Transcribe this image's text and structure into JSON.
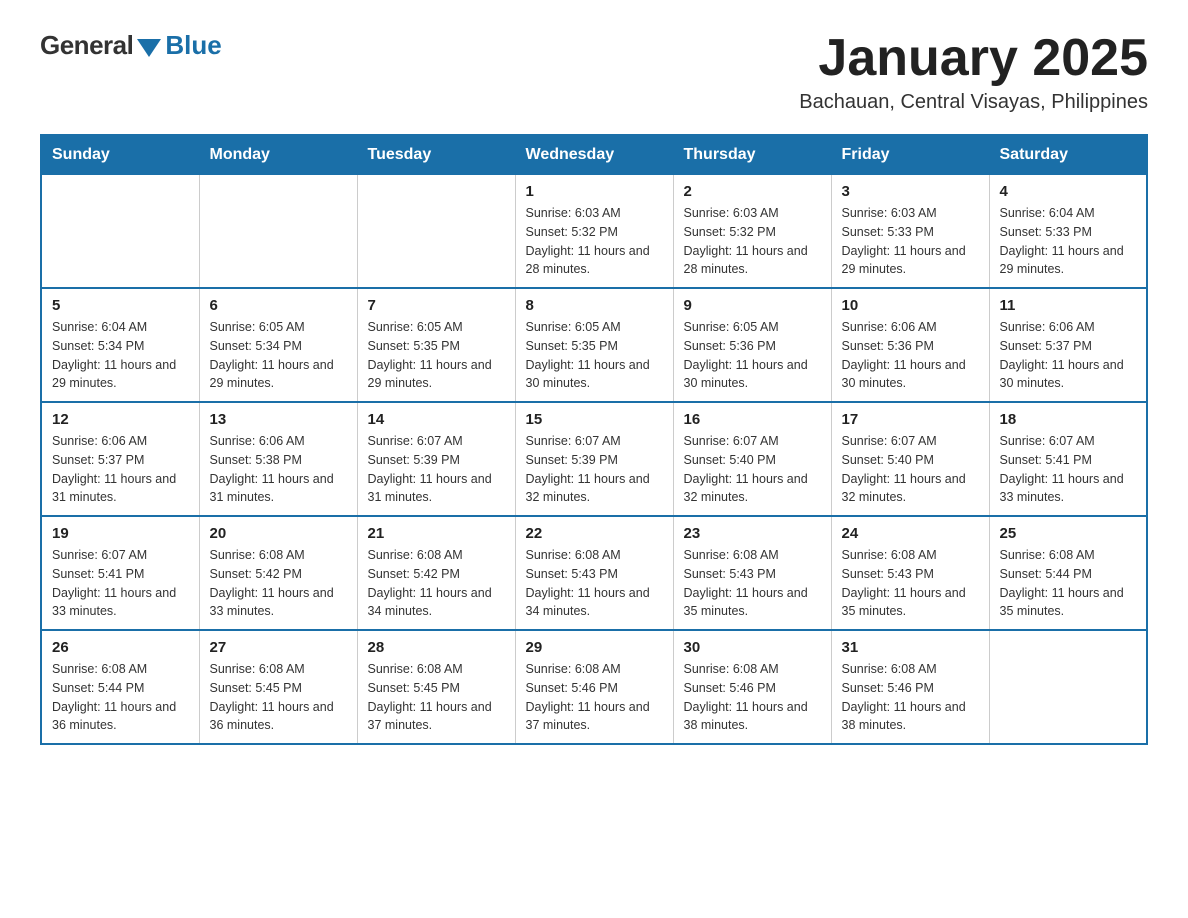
{
  "logo": {
    "general": "General",
    "blue": "Blue"
  },
  "title": "January 2025",
  "location": "Bachauan, Central Visayas, Philippines",
  "weekdays": [
    "Sunday",
    "Monday",
    "Tuesday",
    "Wednesday",
    "Thursday",
    "Friday",
    "Saturday"
  ],
  "weeks": [
    [
      {
        "day": "",
        "info": ""
      },
      {
        "day": "",
        "info": ""
      },
      {
        "day": "",
        "info": ""
      },
      {
        "day": "1",
        "info": "Sunrise: 6:03 AM\nSunset: 5:32 PM\nDaylight: 11 hours and 28 minutes."
      },
      {
        "day": "2",
        "info": "Sunrise: 6:03 AM\nSunset: 5:32 PM\nDaylight: 11 hours and 28 minutes."
      },
      {
        "day": "3",
        "info": "Sunrise: 6:03 AM\nSunset: 5:33 PM\nDaylight: 11 hours and 29 minutes."
      },
      {
        "day": "4",
        "info": "Sunrise: 6:04 AM\nSunset: 5:33 PM\nDaylight: 11 hours and 29 minutes."
      }
    ],
    [
      {
        "day": "5",
        "info": "Sunrise: 6:04 AM\nSunset: 5:34 PM\nDaylight: 11 hours and 29 minutes."
      },
      {
        "day": "6",
        "info": "Sunrise: 6:05 AM\nSunset: 5:34 PM\nDaylight: 11 hours and 29 minutes."
      },
      {
        "day": "7",
        "info": "Sunrise: 6:05 AM\nSunset: 5:35 PM\nDaylight: 11 hours and 29 minutes."
      },
      {
        "day": "8",
        "info": "Sunrise: 6:05 AM\nSunset: 5:35 PM\nDaylight: 11 hours and 30 minutes."
      },
      {
        "day": "9",
        "info": "Sunrise: 6:05 AM\nSunset: 5:36 PM\nDaylight: 11 hours and 30 minutes."
      },
      {
        "day": "10",
        "info": "Sunrise: 6:06 AM\nSunset: 5:36 PM\nDaylight: 11 hours and 30 minutes."
      },
      {
        "day": "11",
        "info": "Sunrise: 6:06 AM\nSunset: 5:37 PM\nDaylight: 11 hours and 30 minutes."
      }
    ],
    [
      {
        "day": "12",
        "info": "Sunrise: 6:06 AM\nSunset: 5:37 PM\nDaylight: 11 hours and 31 minutes."
      },
      {
        "day": "13",
        "info": "Sunrise: 6:06 AM\nSunset: 5:38 PM\nDaylight: 11 hours and 31 minutes."
      },
      {
        "day": "14",
        "info": "Sunrise: 6:07 AM\nSunset: 5:39 PM\nDaylight: 11 hours and 31 minutes."
      },
      {
        "day": "15",
        "info": "Sunrise: 6:07 AM\nSunset: 5:39 PM\nDaylight: 11 hours and 32 minutes."
      },
      {
        "day": "16",
        "info": "Sunrise: 6:07 AM\nSunset: 5:40 PM\nDaylight: 11 hours and 32 minutes."
      },
      {
        "day": "17",
        "info": "Sunrise: 6:07 AM\nSunset: 5:40 PM\nDaylight: 11 hours and 32 minutes."
      },
      {
        "day": "18",
        "info": "Sunrise: 6:07 AM\nSunset: 5:41 PM\nDaylight: 11 hours and 33 minutes."
      }
    ],
    [
      {
        "day": "19",
        "info": "Sunrise: 6:07 AM\nSunset: 5:41 PM\nDaylight: 11 hours and 33 minutes."
      },
      {
        "day": "20",
        "info": "Sunrise: 6:08 AM\nSunset: 5:42 PM\nDaylight: 11 hours and 33 minutes."
      },
      {
        "day": "21",
        "info": "Sunrise: 6:08 AM\nSunset: 5:42 PM\nDaylight: 11 hours and 34 minutes."
      },
      {
        "day": "22",
        "info": "Sunrise: 6:08 AM\nSunset: 5:43 PM\nDaylight: 11 hours and 34 minutes."
      },
      {
        "day": "23",
        "info": "Sunrise: 6:08 AM\nSunset: 5:43 PM\nDaylight: 11 hours and 35 minutes."
      },
      {
        "day": "24",
        "info": "Sunrise: 6:08 AM\nSunset: 5:43 PM\nDaylight: 11 hours and 35 minutes."
      },
      {
        "day": "25",
        "info": "Sunrise: 6:08 AM\nSunset: 5:44 PM\nDaylight: 11 hours and 35 minutes."
      }
    ],
    [
      {
        "day": "26",
        "info": "Sunrise: 6:08 AM\nSunset: 5:44 PM\nDaylight: 11 hours and 36 minutes."
      },
      {
        "day": "27",
        "info": "Sunrise: 6:08 AM\nSunset: 5:45 PM\nDaylight: 11 hours and 36 minutes."
      },
      {
        "day": "28",
        "info": "Sunrise: 6:08 AM\nSunset: 5:45 PM\nDaylight: 11 hours and 37 minutes."
      },
      {
        "day": "29",
        "info": "Sunrise: 6:08 AM\nSunset: 5:46 PM\nDaylight: 11 hours and 37 minutes."
      },
      {
        "day": "30",
        "info": "Sunrise: 6:08 AM\nSunset: 5:46 PM\nDaylight: 11 hours and 38 minutes."
      },
      {
        "day": "31",
        "info": "Sunrise: 6:08 AM\nSunset: 5:46 PM\nDaylight: 11 hours and 38 minutes."
      },
      {
        "day": "",
        "info": ""
      }
    ]
  ]
}
